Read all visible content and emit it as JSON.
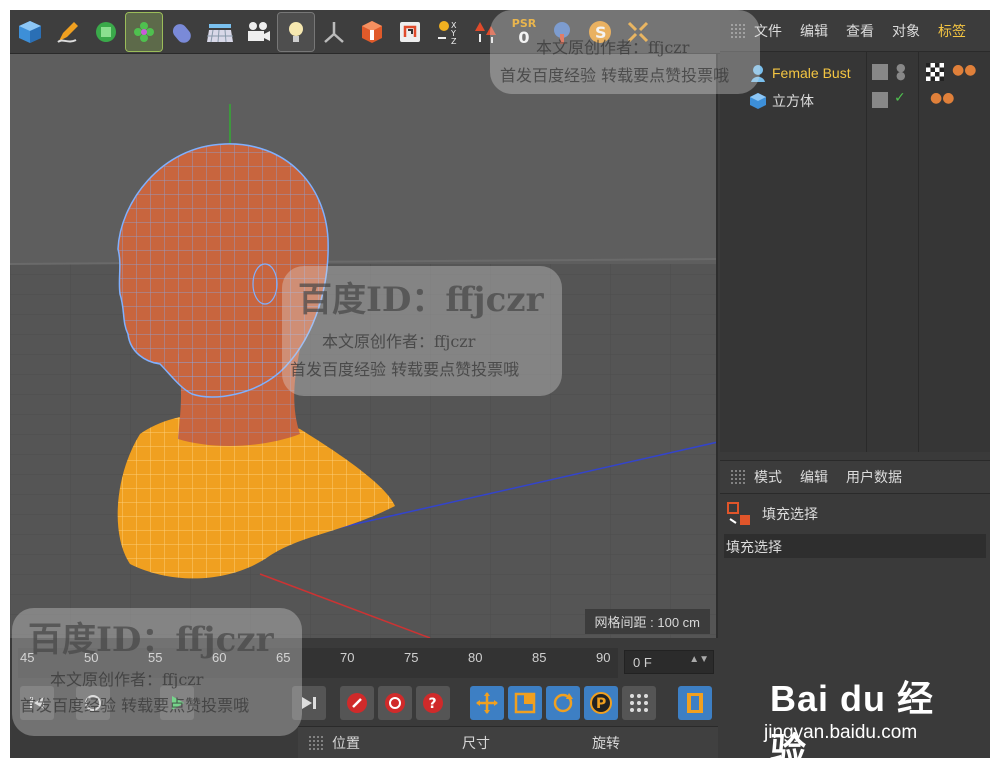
{
  "toolbar": {
    "buttons": [
      "cube-icon",
      "pen-icon",
      "extrude-icon",
      "flower-icon",
      "capsule-icon",
      "floor-icon",
      "camera-icon",
      "bulb-icon",
      "axis-icon",
      "paint-icon",
      "brush-icon",
      "xyz-icon",
      "scale-axis-icon"
    ],
    "psr_label": "PSR",
    "psr_value": "0"
  },
  "viewport": {
    "grid_spacing": "网格间距 : 100 cm",
    "colors": {
      "background": "#5a5a5a",
      "head": "#c8653e",
      "collar": "#f0a020",
      "wire": "#6aa0ff"
    }
  },
  "timeline": {
    "ticks": [
      "45",
      "50",
      "55",
      "60",
      "65",
      "70",
      "75",
      "80",
      "85",
      "90"
    ],
    "current_frame": "0 F"
  },
  "coords": {
    "position": "位置",
    "size": "尺寸",
    "rotation": "旋转"
  },
  "object_manager": {
    "menu": [
      "文件",
      "编辑",
      "查看",
      "对象",
      "标签"
    ],
    "objects": [
      {
        "name": "Female Bust",
        "color": "#f4c542"
      },
      {
        "name": "立方体",
        "color": "#dcdcdc"
      }
    ]
  },
  "attributes": {
    "menu": [
      "模式",
      "编辑",
      "用户数据"
    ],
    "title": "填充选择",
    "section": "填充选择"
  },
  "watermark": {
    "id_text": "百度ID：ffjczr",
    "author": "本文原创作者：ffjczr",
    "notice": "首发百度经验  转载要点赞投票哦"
  },
  "baidu": {
    "logo": "Bai du 经验",
    "url": "jingyan.baidu.com"
  }
}
